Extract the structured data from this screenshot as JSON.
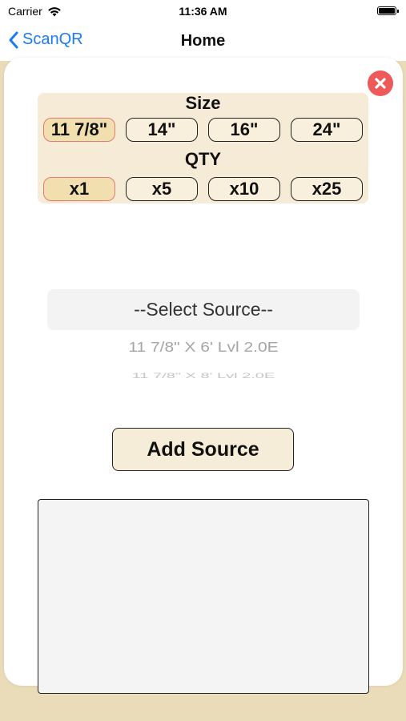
{
  "status_bar": {
    "carrier": "Carrier",
    "time": "11:36 AM"
  },
  "nav": {
    "back_label": "ScanQR",
    "title": "Home"
  },
  "size": {
    "label": "Size",
    "options": [
      "11 7/8\"",
      "14\"",
      "16\"",
      "24\""
    ],
    "selected": "11 7/8\""
  },
  "qty": {
    "label": "QTY",
    "options": [
      "x1",
      "x5",
      "x10",
      "x25"
    ],
    "selected": "x1"
  },
  "source_picker": {
    "selected": "--Select Source--",
    "items": [
      "11 7/8\" X 6' Lvl 2.0E",
      "11 7/8\" X 8' Lvl 2.0E"
    ]
  },
  "add_source": {
    "label": "Add Source"
  },
  "notes": {
    "value": ""
  },
  "colors": {
    "accent_blue": "#1a7cf5",
    "background_tan": "#eadcb8",
    "panel_cream": "#f5ebd7",
    "selected_border": "#e57a6e",
    "close_red": "#ee5a5a"
  },
  "icons": {
    "back": "chevron-left-icon",
    "close": "close-circle-icon",
    "wifi": "wifi-icon",
    "battery": "battery-icon"
  }
}
